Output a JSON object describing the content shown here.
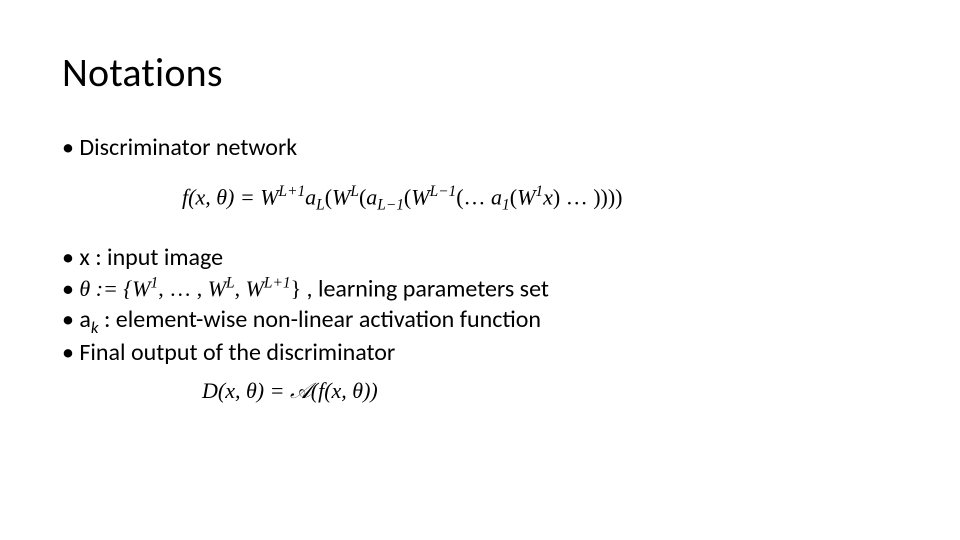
{
  "title": "Notations",
  "bullets": {
    "b1": "Discriminator network",
    "f1_lhs": "f(x, θ) = ",
    "f1_rhs_a": "W",
    "f1_sup_Lp1": "L+1",
    "f1_aL": "a",
    "f1_sub_L": "L",
    "f1_open": "(",
    "f1_WL": "W",
    "f1_sup_L": "L",
    "f1_open2": "(",
    "f1_aLm1": "a",
    "f1_sub_Lm1": "L−1",
    "f1_open3": "(",
    "f1_WLm1": "W",
    "f1_sup_Lm1": "L−1",
    "f1_open4": "(",
    "f1_dots1": "… ",
    "f1_a1": "a",
    "f1_sub_1": "1",
    "f1_open5": "(",
    "f1_W1": "W",
    "f1_sup_1": "1",
    "f1_x": "x",
    "f1_close1": ")",
    "f1_dots2": " … ",
    "f1_close_all": "))))",
    "b2": "x : input image",
    "theta_lhs": "θ := {",
    "theta_W1": "W",
    "theta_sup_1": "1",
    "theta_comma1": ", … , ",
    "theta_WL": "W",
    "theta_sup_L": "L",
    "theta_comma2": ", ",
    "theta_WLp1": "W",
    "theta_sup_Lp1": "L+1",
    "theta_close": "}",
    "b3_tail": " , learning parameters set",
    "b4_pre": "a",
    "b4_sub_k": "k",
    "b4_tail": " : element-wise non-linear activation function",
    "b5": "Final output of the discriminator",
    "f2": "D(x, θ) = 𝒜(f(x, θ))"
  }
}
